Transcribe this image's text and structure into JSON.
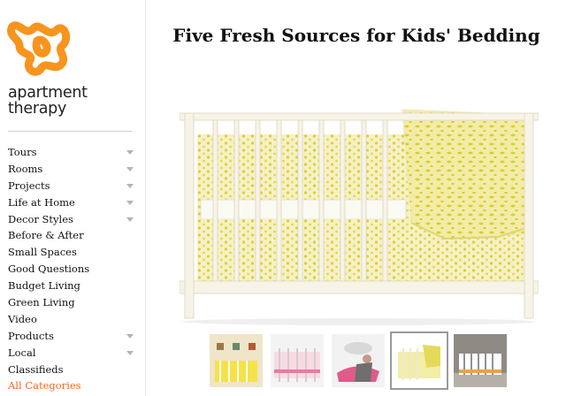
{
  "brand": {
    "name": "apartment therapy",
    "line1": "apartment",
    "line2": "therapy",
    "logo_color": "#f7941d"
  },
  "nav": [
    {
      "label": "Tours",
      "has_dropdown": true
    },
    {
      "label": "Rooms",
      "has_dropdown": true
    },
    {
      "label": "Projects",
      "has_dropdown": true
    },
    {
      "label": "Life at Home",
      "has_dropdown": true
    },
    {
      "label": "Decor Styles",
      "has_dropdown": true
    },
    {
      "label": "Before & After",
      "has_dropdown": false
    },
    {
      "label": "Small Spaces",
      "has_dropdown": false
    },
    {
      "label": "Good Questions",
      "has_dropdown": false
    },
    {
      "label": "Budget Living",
      "has_dropdown": false
    },
    {
      "label": "Green Living",
      "has_dropdown": false
    },
    {
      "label": "Video",
      "has_dropdown": false
    },
    {
      "label": "Products",
      "has_dropdown": true
    },
    {
      "label": "Local",
      "has_dropdown": true
    },
    {
      "label": "Classifieds",
      "has_dropdown": false
    },
    {
      "label": "All Categories",
      "has_dropdown": false,
      "active": true
    }
  ],
  "colors": {
    "accent": "#f26a21",
    "bedding_yellow": "#e8e26a",
    "crib_white": "#f4f0e2"
  },
  "article": {
    "title": "Five Fresh Sources for Kids' Bedding"
  },
  "thumbnails": {
    "selected_index": 3,
    "count": 5
  }
}
